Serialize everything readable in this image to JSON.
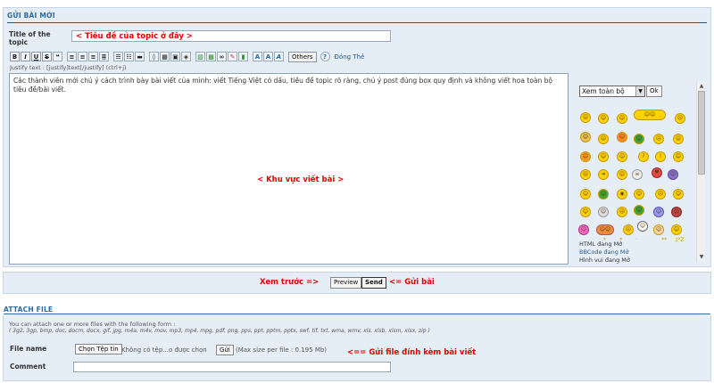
{
  "new_topic": {
    "section_title": "GỬI BÀI MỚI",
    "title_label": "Title of the topic",
    "title_value": "< Tiêu đề của topic ở đây >",
    "toolbar": {
      "bold": "B",
      "italic": "I",
      "underline": "U",
      "strike": "S",
      "others_label": "Others",
      "help_label": "?",
      "close_tags_label": "Đóng Thẻ",
      "hint": "Justify text : [justify]text[/justify] (ctrl+j)"
    },
    "message_text": "Các thành viên mới chú ý cách trình bày bài viết của mình: viết Tiếng Việt có dấu, tiêu đề topic rõ ràng, chú ý post đúng box quy định và không viết hoa toàn bộ tiêu đề/bài viết.",
    "body_annotation": "< Khu vực viết bài >",
    "view_select": "Xem toàn bộ",
    "ok_label": "Ok",
    "status": {
      "html": "HTML đang Mở",
      "bbcode": "BBCode đang Mở",
      "smilies": "Hình vui đang Mở"
    }
  },
  "submit_bar": {
    "preview_annotation": "Xem trước =>",
    "preview_label": "Preview",
    "send_label": "Send",
    "send_annotation": "<= Gửi bài"
  },
  "attach": {
    "section_title": "ATTACH FILE",
    "description": "You can attach one or more files with the following form :",
    "extensions": "( 3g2, 3gp, bmp, doc, docm, docx, gif, jpg, m4a, m4v, mov, mp3, mp4, mpg, pdf, png, pps, ppt, pptm, pptx, swf, tif, txt, wma, wmv, xls, xlsb, xlsm, xlsx, zip )",
    "file_name_label": "File name",
    "choose_file_label": "Chọn Tệp tin",
    "no_file_text": "Không có tệp...o được chọn",
    "send_label": "Gửi",
    "max_size": "(Max size per file : 0.195 Mb)",
    "annotation": "<== Gửi file đính kèm bài viết",
    "comment_label": "Comment"
  }
}
